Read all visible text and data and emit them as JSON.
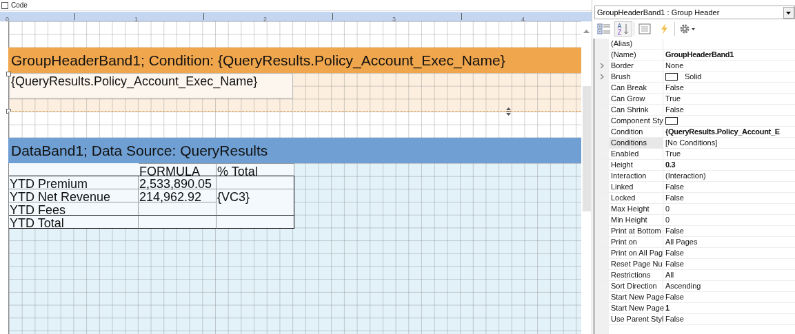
{
  "code_tab": {
    "label": "Code",
    "checked": false
  },
  "ruler": {
    "labels": [
      "0",
      "1",
      "2",
      "3",
      "4"
    ]
  },
  "group_header_band": {
    "title": "GroupHeaderBand1; Condition: {QueryResults.Policy_Account_Exec_Name}",
    "field": "{QueryResults.Policy_Account_Exec_Name}"
  },
  "data_band": {
    "title": "DataBand1; Data Source: QueryResults",
    "table": {
      "columns": [
        "FORMULA",
        "% Total"
      ],
      "rows": [
        {
          "label": "YTD Premium",
          "formula": "2,533,890.05",
          "total": ""
        },
        {
          "label": "YTD Net Revenue",
          "formula": "214,962.92",
          "total": "{VC3}"
        },
        {
          "label": "YTD Fees",
          "formula": "",
          "total": ""
        },
        {
          "label": "YTD Total",
          "formula": "",
          "total": ""
        }
      ]
    }
  },
  "properties_panel": {
    "object_selector": "GroupHeaderBand1 : Group Header",
    "toolbar": [
      {
        "kind": "categorized",
        "selected": false
      },
      {
        "kind": "alphabetical",
        "selected": true
      },
      {
        "kind": "properties",
        "selected": false
      },
      {
        "kind": "events",
        "selected": false
      },
      {
        "kind": "settings",
        "selected": false
      }
    ],
    "properties": [
      {
        "name": "(Alias)",
        "kind": "text",
        "expandable": false,
        "selected": false
      },
      {
        "name": "(Name)",
        "value": "GroupHeaderBand1",
        "kind": "text",
        "bold": true,
        "expandable": false,
        "selected": false
      },
      {
        "name": "Border",
        "value": "None",
        "kind": "text",
        "bold": false,
        "expandable": true,
        "selected": false
      },
      {
        "name": "Brush",
        "value": "Solid",
        "kind": "swatch",
        "bold": false,
        "expandable": true,
        "selected": false
      },
      {
        "name": "Can Break",
        "value": "False",
        "kind": "text",
        "bold": false,
        "expandable": false,
        "selected": false
      },
      {
        "name": "Can Grow",
        "value": "True",
        "kind": "text",
        "bold": false,
        "expandable": false,
        "selected": false
      },
      {
        "name": "Can Shrink",
        "value": "False",
        "kind": "text",
        "bold": false,
        "expandable": false,
        "selected": false
      },
      {
        "name": "Component Sty",
        "kind": "swatch",
        "expandable": false,
        "selected": false
      },
      {
        "name": "Condition",
        "value": "{QueryResults.Policy_Account_E",
        "kind": "text",
        "bold": true,
        "expandable": false,
        "selected": false
      },
      {
        "name": "Conditions",
        "value": "[No Conditions]",
        "kind": "text",
        "bold": false,
        "expandable": false,
        "selected": true
      },
      {
        "name": "Enabled",
        "value": "True",
        "kind": "text",
        "bold": false,
        "expandable": false,
        "selected": false
      },
      {
        "name": "Height",
        "value": "0.3",
        "kind": "text",
        "bold": true,
        "expandable": false,
        "selected": false
      },
      {
        "name": "Interaction",
        "value": "(Interaction)",
        "kind": "text",
        "bold": false,
        "expandable": false,
        "selected": false
      },
      {
        "name": "Linked",
        "value": "False",
        "kind": "text",
        "bold": false,
        "expandable": false,
        "selected": false
      },
      {
        "name": "Locked",
        "value": "False",
        "kind": "text",
        "bold": false,
        "expandable": false,
        "selected": false
      },
      {
        "name": "Max Height",
        "value": "0",
        "kind": "text",
        "bold": false,
        "expandable": false,
        "selected": false
      },
      {
        "name": "Min Height",
        "value": "0",
        "kind": "text",
        "bold": false,
        "expandable": false,
        "selected": false
      },
      {
        "name": "Print at Bottom",
        "value": "False",
        "kind": "text",
        "bold": false,
        "expandable": false,
        "selected": false
      },
      {
        "name": "Print on",
        "value": "All Pages",
        "kind": "text",
        "bold": false,
        "expandable": false,
        "selected": false
      },
      {
        "name": "Print on All Pag",
        "value": "False",
        "kind": "text",
        "bold": false,
        "expandable": false,
        "selected": false
      },
      {
        "name": "Reset Page Nu",
        "value": "False",
        "kind": "text",
        "bold": false,
        "expandable": false,
        "selected": false
      },
      {
        "name": "Restrictions",
        "value": "All",
        "kind": "text",
        "bold": false,
        "expandable": false,
        "selected": false
      },
      {
        "name": "Sort Direction",
        "value": "Ascending",
        "kind": "text",
        "bold": false,
        "expandable": false,
        "selected": false
      },
      {
        "name": "Start New Page",
        "value": "False",
        "kind": "text",
        "bold": false,
        "expandable": false,
        "selected": false
      },
      {
        "name": "Start New Page",
        "value": "1",
        "kind": "text",
        "bold": true,
        "expandable": false,
        "selected": false
      },
      {
        "name": "Use Parent Styl",
        "value": "False",
        "kind": "text",
        "bold": false,
        "expandable": false,
        "selected": false
      }
    ]
  }
}
